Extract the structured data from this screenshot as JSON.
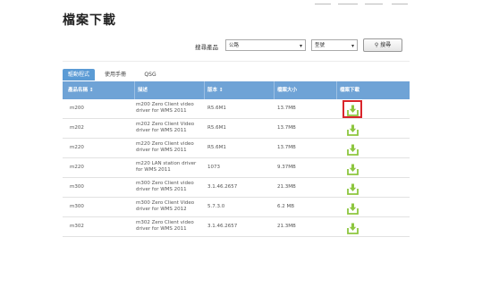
{
  "page": {
    "title": "檔案下載"
  },
  "filter": {
    "product_label": "搜尋產品",
    "category_select": "公路",
    "model_select": "型號",
    "search_label": "搜尋"
  },
  "tabs": [
    {
      "label": "驅動程式",
      "active": true
    },
    {
      "label": "使用手冊",
      "active": false
    },
    {
      "label": "QSG",
      "active": false
    }
  ],
  "table": {
    "headers": [
      "產品名稱 ↕",
      "描述",
      "版本 ↕",
      "檔案大小",
      "檔案下載"
    ],
    "rows": [
      {
        "name": "m200",
        "desc1": "m200 Zero Client video",
        "desc2": "driver for WMS 2011",
        "version": "R5.6M1",
        "size": "13.7MB",
        "highlighted": true
      },
      {
        "name": "m202",
        "desc1": "m202 Zero Client Video",
        "desc2": "driver for WMS 2011",
        "version": "R5.6M1",
        "size": "13.7MB",
        "highlighted": false
      },
      {
        "name": "m220",
        "desc1": "m220 Zero Client video",
        "desc2": "driver for WMS 2011",
        "version": "R5.6M1",
        "size": "13.7MB",
        "highlighted": false
      },
      {
        "name": "m220",
        "desc1": "m220 LAN station driver",
        "desc2": "for WMS 2011",
        "version": "1073",
        "size": "9.37MB",
        "highlighted": false
      },
      {
        "name": "m300",
        "desc1": "m300 Zero Client video",
        "desc2": "driver for WMS 2011",
        "version": "3.1.46.2657",
        "size": "21.3MB",
        "highlighted": false
      },
      {
        "name": "m300",
        "desc1": "m300 Zero Client Video",
        "desc2": "driver for WMS 2012",
        "version": "5.7.3.0",
        "size": "6.2 MB",
        "highlighted": false
      },
      {
        "name": "m302",
        "desc1": "m302 Zero Client video",
        "desc2": "driver for WMS 2011",
        "version": "3.1.46.2657",
        "size": "21.3MB",
        "highlighted": false
      }
    ]
  },
  "icons": {
    "download": "download-icon",
    "search": "search-icon",
    "dropdown": "chevron-down-icon"
  },
  "colors": {
    "header": "#6fa3d6",
    "tab_active": "#5b9bd5",
    "download_green": "#8dc63f",
    "highlight_red": "#d9252b"
  }
}
